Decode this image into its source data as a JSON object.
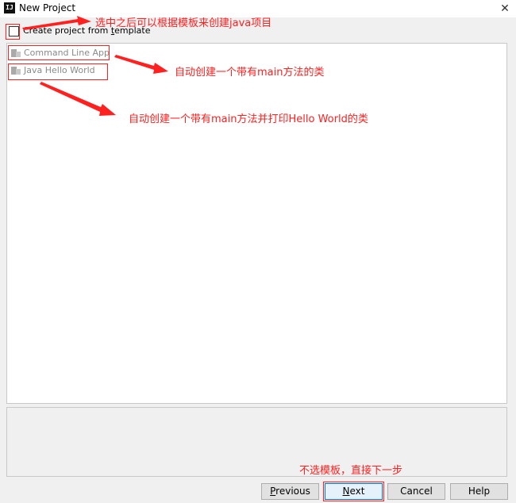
{
  "window": {
    "title": "New Project",
    "app_icon": "intellij-icon",
    "app_icon_text": "IJ",
    "close_glyph": "✕"
  },
  "template_checkbox": {
    "label_prefix": "Create project from ",
    "label_mnemonic": "t",
    "label_suffix": "emplate",
    "checked": false
  },
  "templates": [
    {
      "label": "Command Line App",
      "icon": "template-icon"
    },
    {
      "label": "Java Hello World",
      "icon": "template-icon"
    }
  ],
  "buttons": {
    "previous": {
      "mnemonic": "P",
      "rest": "revious"
    },
    "next": {
      "mnemonic": "N",
      "rest": "ext"
    },
    "cancel": "Cancel",
    "help": "Help"
  },
  "annotations": {
    "checkbox_note": "选中之后可以根据模板来创建java项目",
    "command_line_note": "自动创建一个带有main方法的类",
    "hello_world_note": "自动创建一个带有main方法并打印Hello World的类",
    "next_note": "不选模板，直接下一步"
  },
  "colors": {
    "annotation": "#ff2020",
    "primary_border": "#0078d7"
  }
}
